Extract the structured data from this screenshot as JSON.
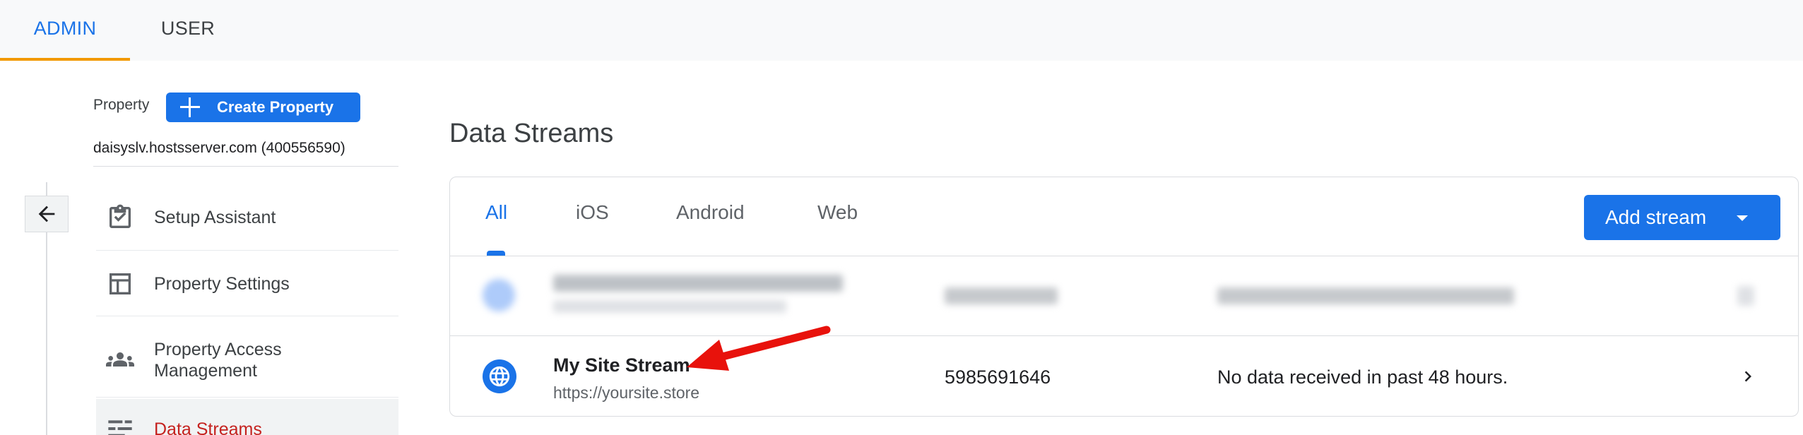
{
  "top_tabs": [
    {
      "label": "ADMIN",
      "active": true
    },
    {
      "label": "USER",
      "active": false
    }
  ],
  "property": {
    "label": "Property",
    "create_button": "Create Property",
    "name": "daisyslv.hostsserver.com (400556590)"
  },
  "nav_items": [
    {
      "label": "Setup Assistant",
      "icon": "clipboard-check-icon"
    },
    {
      "label": "Property Settings",
      "icon": "layout-icon"
    },
    {
      "label": "Property Access Management",
      "icon": "people-icon"
    },
    {
      "label": "Data Streams",
      "icon": "data-streams-icon",
      "active": true
    }
  ],
  "main": {
    "title": "Data Streams",
    "tabs": [
      "All",
      "iOS",
      "Android",
      "Web"
    ],
    "active_tab": "All",
    "add_button": "Add stream"
  },
  "streams": [
    {
      "name": "My Site Stream",
      "url": "https://yoursite.store",
      "id": "5985691646",
      "status": "No data received in past 48 hours.",
      "icon": "globe-icon"
    }
  ],
  "colors": {
    "accent": "#1a73e8",
    "tab_underline": "#f29900",
    "active_nav_text": "#c5221f",
    "annotation_arrow": "#e8120c"
  }
}
